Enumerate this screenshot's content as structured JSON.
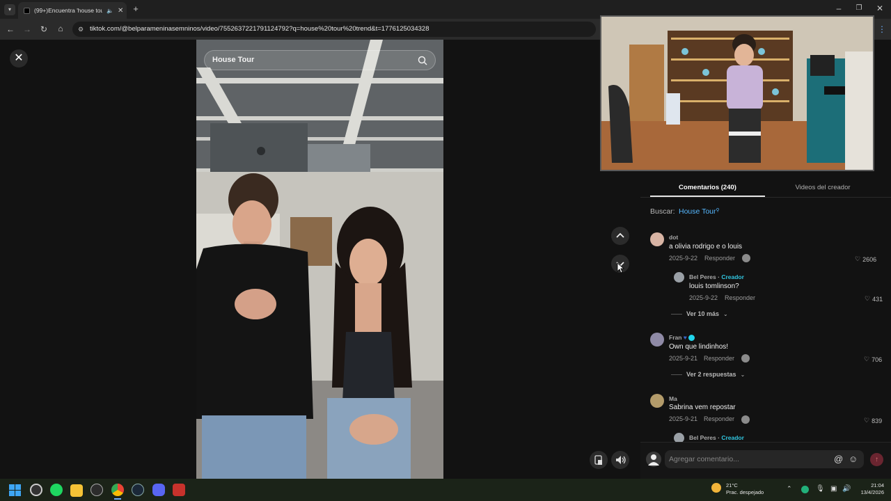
{
  "browser": {
    "tab_title": "(99+)Encuentra 'house tour",
    "url": "tiktok.com/@belparameninasemninos/video/7552637221791124792?q=house%20tour%20trend&t=1776125034328"
  },
  "video": {
    "search_placeholder": "House Tour"
  },
  "comments_panel": {
    "tabs": [
      "Comentarios (240)",
      "Videos del creador"
    ],
    "search_prefix": "Buscar:",
    "search_term": "House Tour",
    "comments": [
      {
        "user": "dot",
        "text": "a olivia rodrigo e o louis",
        "date": "2025-9-22",
        "reply_label": "Responder",
        "likes": "2606"
      },
      {
        "user": "Bel Peres",
        "creator_tag": "Creador",
        "text": "louis tomlinson?",
        "date": "2025-9-22",
        "reply_label": "Responder",
        "likes": "431"
      },
      {
        "view_more": "Ver 10 más"
      },
      {
        "user": "Fran",
        "text": "Own que lindinhos!",
        "date": "2025-9-21",
        "reply_label": "Responder",
        "likes": "706"
      },
      {
        "view_more": "Ver 2 respuestas"
      },
      {
        "user": "Ma",
        "text": "Sabrina vem repostar",
        "date": "2025-9-21",
        "reply_label": "Responder",
        "likes": "839"
      },
      {
        "user": "Bel Peres",
        "creator_tag": "Creador"
      }
    ],
    "comment_placeholder": "Agregar comentario...",
    "separator": "·"
  },
  "taskbar": {
    "temperature": "21°C",
    "weather": "Prac. despejado",
    "time": "21:04",
    "date": "13/4/2026"
  }
}
